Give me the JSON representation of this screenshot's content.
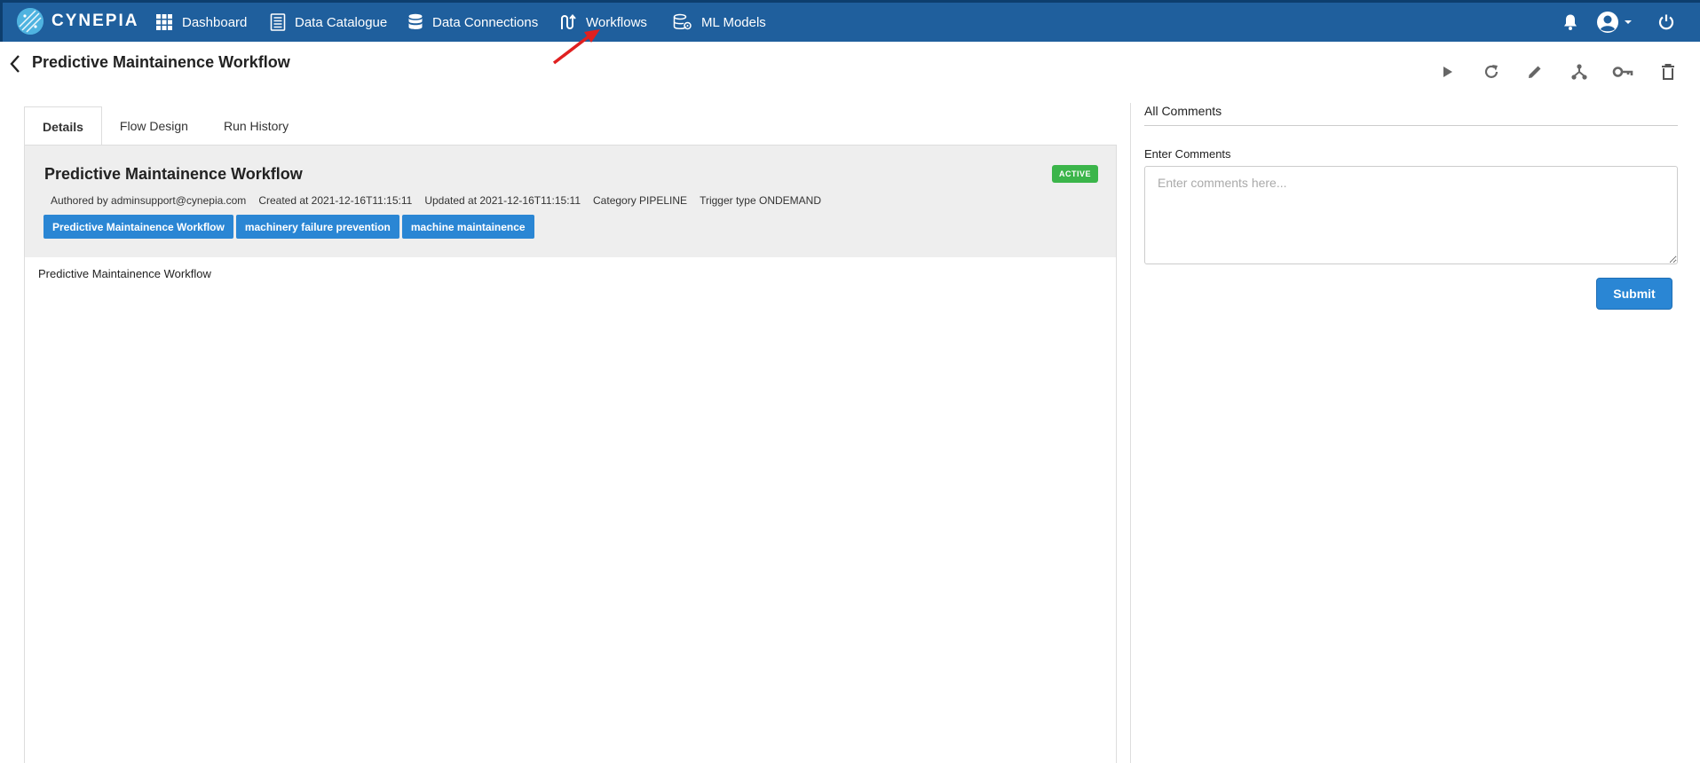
{
  "nav": {
    "brand": "CYNEPIA",
    "items": [
      {
        "label": "Dashboard",
        "icon": "grid-icon"
      },
      {
        "label": "Data Catalogue",
        "icon": "catalogue-icon"
      },
      {
        "label": "Data Connections",
        "icon": "database-icon"
      },
      {
        "label": "Workflows",
        "icon": "workflow-icon"
      },
      {
        "label": "ML Models",
        "icon": "ml-models-icon"
      }
    ],
    "right_icons": [
      "bell-icon",
      "user-avatar-icon",
      "power-icon"
    ]
  },
  "page": {
    "title": "Predictive Maintainence Workflow"
  },
  "toolbar": [
    "play-icon",
    "refresh-icon",
    "edit-icon",
    "share-icon",
    "key-icon",
    "delete-icon"
  ],
  "tabs": [
    {
      "label": "Details",
      "active": true
    },
    {
      "label": "Flow Design",
      "active": false
    },
    {
      "label": "Run History",
      "active": false
    }
  ],
  "details": {
    "title": "Predictive Maintainence Workflow",
    "status": "ACTIVE",
    "author": "Authored by adminsupport@cynepia.com",
    "created": "Created at 2021-12-16T11:15:11",
    "updated": "Updated at 2021-12-16T11:15:11",
    "category": "Category PIPELINE",
    "trigger": "Trigger type ONDEMAND",
    "tags": [
      "Predictive Maintainence Workflow",
      "machinery failure prevention",
      "machine maintainence"
    ],
    "description": "Predictive Maintainence Workflow"
  },
  "comments": {
    "title": "All Comments",
    "label": "Enter Comments",
    "placeholder": "Enter comments here...",
    "submit": "Submit"
  },
  "colors": {
    "navbar": "#1f5f9d",
    "accent": "#2a86d4",
    "active": "#3bb54a",
    "annotation_arrow": "#e02020"
  }
}
